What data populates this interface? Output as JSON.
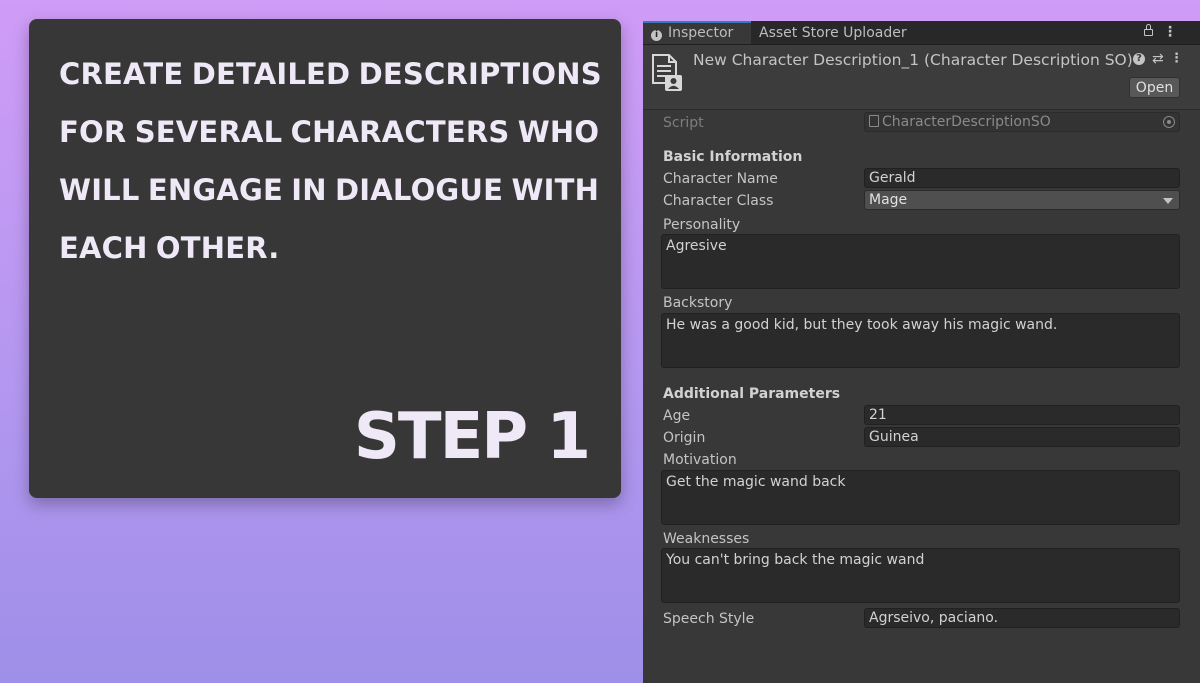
{
  "promo": {
    "text": "Create detailed descriptions for several characters who will engage in dialogue with each other.",
    "step": "STEP 1"
  },
  "tabs": {
    "inspector": "Inspector",
    "asset_store": "Asset Store Uploader"
  },
  "header": {
    "title": "New Character Description_1 (Character Description SO)",
    "open_button": "Open"
  },
  "script": {
    "label": "Script",
    "value": "CharacterDescriptionSO"
  },
  "basic": {
    "header": "Basic Information",
    "name_label": "Character Name",
    "name_value": "Gerald",
    "class_label": "Character Class",
    "class_value": "Mage",
    "personality_label": "Personality",
    "personality_value": "Agresive",
    "backstory_label": "Backstory",
    "backstory_value": "He was a good kid, but they took away his magic wand."
  },
  "additional": {
    "header": "Additional Parameters",
    "age_label": "Age",
    "age_value": "21",
    "origin_label": "Origin",
    "origin_value": "Guinea",
    "motivation_label": "Motivation",
    "motivation_value": "Get the magic wand back",
    "weaknesses_label": "Weaknesses",
    "weaknesses_value": "You can't bring back the magic wand",
    "speech_label": "Speech Style",
    "speech_value": "Agrseivo, paciano."
  }
}
